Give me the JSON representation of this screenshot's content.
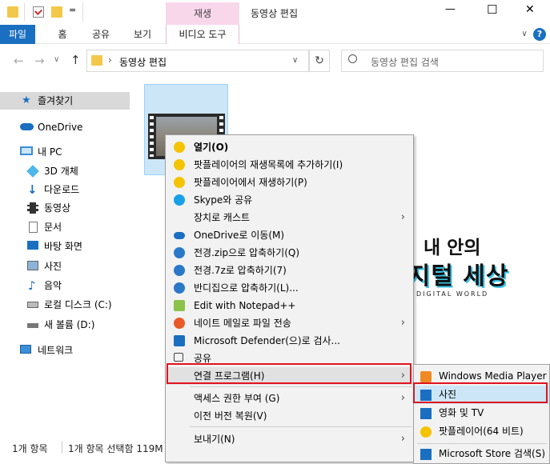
{
  "titlebar": {
    "window_title": "동영상 편집",
    "tool_tab": "재생",
    "minimize": "—",
    "maximize": "☐",
    "close": "✕",
    "qa_dropdown": "="
  },
  "ribbon": {
    "tabs": [
      "파일",
      "홈",
      "공유",
      "보기"
    ],
    "video_tools": "비디오 도구",
    "collapse": "∨",
    "help": "?"
  },
  "address": {
    "back": "←",
    "forward": "→",
    "recent": "∨",
    "up": "↑",
    "path_sep": "›",
    "path": "동영상 편집",
    "dropdown": "∨",
    "refresh": "↻",
    "search_placeholder": "동영상 편집 검색"
  },
  "nav": {
    "quick_access": "즐겨찾기",
    "onedrive": "OneDrive",
    "this_pc": "내 PC",
    "items": [
      "3D 개체",
      "다운로드",
      "동영상",
      "문서",
      "바탕 화면",
      "사진",
      "음악",
      "로컬 디스크 (C:)",
      "새 볼륨 (D:)"
    ],
    "network": "네트워크"
  },
  "status": {
    "count": "1개 항목",
    "selected": "1개 항목 선택함 119M"
  },
  "watermark": {
    "line1": "내 안의",
    "line2": "디지털 세상",
    "line3": "DIGITAL WORLD"
  },
  "menu": {
    "items": [
      "열기(O)",
      "팟플레이어의 재생목록에 추가하기(I)",
      "팟플레이어에서 재생하기(P)",
      "Skype와 공유",
      "장치로 캐스트",
      "OneDrive로 이동(M)",
      "전경.zip으로 압축하기(Q)",
      "전경.7z로 압축하기(7)",
      "반디집으로 압축하기(L)...",
      "Edit with Notepad++",
      "네이트 메일로 파일 전송",
      "Microsoft Defender(으)로 검사...",
      "공유",
      "연결 프로그램(H)",
      "액세스 권한 부여 (G)",
      "이전 버전 복원(V)",
      "보내기(N)"
    ],
    "submenu_arrow": "›"
  },
  "submenu": {
    "items": [
      "Windows Media Player",
      "사진",
      "영화 및 TV",
      "팟플레이어(64 비트)",
      "Microsoft Store 검색(S)"
    ]
  },
  "colors": {
    "accent": "#1a6fc0",
    "highlight": "#cde6f7",
    "red": "#e0141e",
    "pot": "#f5c400"
  }
}
